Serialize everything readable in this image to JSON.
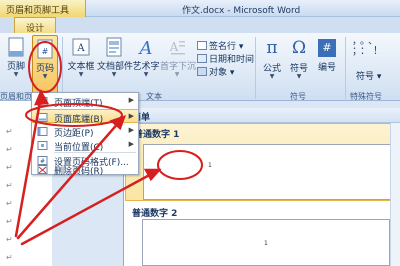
{
  "titlebar": {
    "context_label": "页眉和页脚工具",
    "doc_title": "作文.docx - Microsoft Word"
  },
  "tabs": {
    "design": "设计"
  },
  "ribbon": {
    "footer_label": "页脚",
    "page_number_label": "页码",
    "textbox_label": "文本框",
    "docparts_label": "文档部件",
    "wordart_label": "艺术字",
    "dropcap_label": "首字下沉",
    "signature_line_label": "签名行",
    "datetime_label": "日期和时间",
    "object_label": "对象",
    "formula_label": "公式",
    "symbol_label": "符号",
    "numbering_label": "编号",
    "symbol2_label": "符号",
    "group_text": "文本",
    "group_symbols": "符号",
    "group_special_symbols": "特殊符号",
    "group_header_footer": "页眉和页脚"
  },
  "menu": {
    "items": [
      {
        "label": "页面顶端(T)",
        "has_submenu": true
      },
      {
        "label": "页面底端(B)",
        "has_submenu": true,
        "highlighted": true
      },
      {
        "label": "页边距(P)",
        "has_submenu": true
      },
      {
        "label": "当前位置(C)",
        "has_submenu": true
      },
      {
        "label": "设置页码格式(F)...",
        "has_submenu": false
      },
      {
        "label": "删除页码(R)",
        "has_submenu": false
      }
    ]
  },
  "gallery": {
    "header": "简单",
    "item1_title": "普通数字 1",
    "item1_sample": "1",
    "item2_title": "普通数字 2",
    "item2_sample": "1"
  },
  "colors": {
    "accent_gold": "#f7c25a",
    "annotation_red": "#d62020",
    "ribbon_blue": "#dbe7f5"
  }
}
